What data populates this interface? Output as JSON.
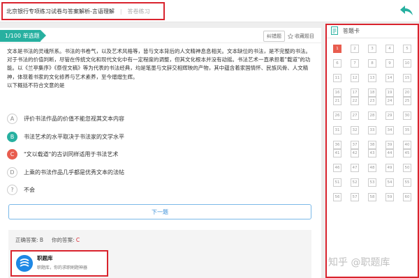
{
  "header": {
    "title": "北京银行专项练习试卷与答案解析-言语理解",
    "subtitle": "答卷练习",
    "back_icon": "back-arrow-icon",
    "accent_color": "#27b0a0"
  },
  "question": {
    "tag": "1/100 单选题",
    "tools": {
      "report_label": "纠错题",
      "favorite_label": "收藏题目"
    },
    "passage": "文本是书法的灵魂所系。书法的书卷气，以及艺术风格等，皆与文本背后的人文精神息息相关。文本缺位的书法，是不完整的书法。对于书法的价值判断，尽管在传统文化和现代文化中有一定程度的调整，但其文化根本并没有动摇。书法艺术一直承担着\"载道\"的功能。以《兰亭集序》《祭侄文稿》等为代表的书法经典，均是笔墨与文辞交相辉映的产物，其中蕴含着家国情怀、民族风骨、人文精神，体现着书家的文化修养与艺术素养，至今熠熠生辉。",
    "prompt": "以下概括不符合文意的是",
    "options": [
      {
        "key": "A",
        "text": "评价书法作品的价值不能忽视其文本内容"
      },
      {
        "key": "B",
        "text": "书法艺术的水平取决于书法家的文学水平"
      },
      {
        "key": "C",
        "text": "\"文以载道\"的古训同样适用于书法艺术"
      },
      {
        "key": "D",
        "text": "上乘的书法作品几乎都是优秀文本的法帖"
      },
      {
        "key": "?",
        "text": "不会"
      }
    ],
    "next_label": "下一题"
  },
  "answer": {
    "correct_label": "正确答案:",
    "correct_value": "B",
    "yours_label": "你的答案:",
    "yours_value": "C"
  },
  "app_promo": {
    "name": "职题库",
    "desc": "职题库，你的求职刷题神器",
    "logo_icon": "zhitiku-logo-icon"
  },
  "answer_card": {
    "title": "答题卡",
    "icon": "answer-card-icon",
    "current": 1,
    "numbers": [
      1,
      2,
      3,
      4,
      5,
      6,
      7,
      8,
      9,
      10,
      11,
      12,
      13,
      14,
      15,
      16,
      17,
      18,
      19,
      20,
      21,
      22,
      23,
      24,
      25,
      26,
      27,
      28,
      29,
      30,
      31,
      32,
      33,
      34,
      35,
      36,
      37,
      38,
      39,
      40,
      41,
      42,
      43,
      44,
      45,
      46,
      47,
      48,
      49,
      50,
      51,
      52,
      53,
      54,
      55,
      56,
      57,
      58,
      59,
      60
    ]
  },
  "watermark": "知乎 @职题库"
}
